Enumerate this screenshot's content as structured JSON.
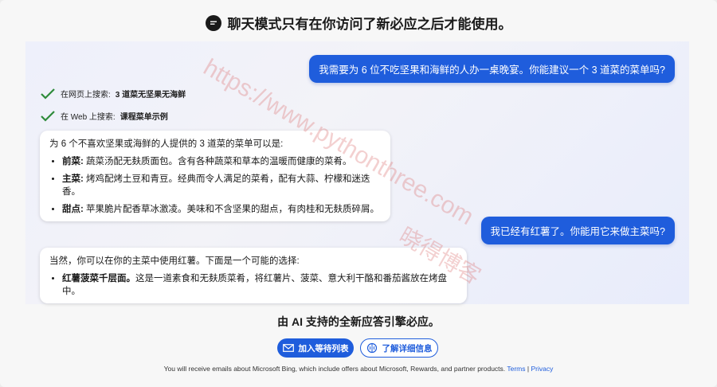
{
  "banner": {
    "text": "聊天模式只有在你访问了新必应之后才能使用。"
  },
  "chat": {
    "user_message_1": "我需要为 6 位不吃坚果和海鲜的人办一桌晚宴。你能建议一个 3 道菜的菜单吗?",
    "searches": [
      {
        "prefix": "在网页上搜索: ",
        "query": "3 道菜无坚果无海鲜"
      },
      {
        "prefix": "在 Web 上搜索: ",
        "query": "课程菜单示例"
      }
    ],
    "bot_reply_1": {
      "intro": "为 6 个不喜欢坚果或海鲜的人提供的 3 道菜的菜单可以是:",
      "items": [
        {
          "label": "前菜:",
          "text": " 蔬菜汤配无麸质面包。含有各种蔬菜和草本的温暖而健康的菜肴。"
        },
        {
          "label": "主菜:",
          "text": " 烤鸡配烤土豆和青豆。经典而令人满足的菜肴，配有大蒜、柠檬和迷迭香。"
        },
        {
          "label": "甜点:",
          "text": " 苹果脆片配香草冰激凌。美味和不含坚果的甜点，有肉桂和无麸质碎屑。"
        }
      ]
    },
    "user_message_2": "我已经有红薯了。你能用它来做主菜吗?",
    "bot_reply_2": {
      "intro": "当然，你可以在你的主菜中使用红薯。下面是一个可能的选择:",
      "items": [
        {
          "label": "红薯菠菜千层面。",
          "text": "这是一道素食和无麸质菜肴，将红薯片、菠菜、意大利干酪和番茄酱放在烤盘中。"
        }
      ]
    }
  },
  "watermark": {
    "url": "https://www.pythonthree.com",
    "name": "晓得博客"
  },
  "footer": {
    "title": "由 AI 支持的全新应答引擎必应。",
    "waitlist_button": "加入等待列表",
    "learn_more_button": "了解详细信息",
    "legal_text": "You will receive emails about Microsoft Bing, which include offers about Microsoft, Rewards, and partner products.",
    "terms_link": "Terms",
    "separator": "|",
    "privacy_link": "Privacy"
  },
  "colors": {
    "accent": "#1f5ddc",
    "check": "#2e8b3a"
  }
}
